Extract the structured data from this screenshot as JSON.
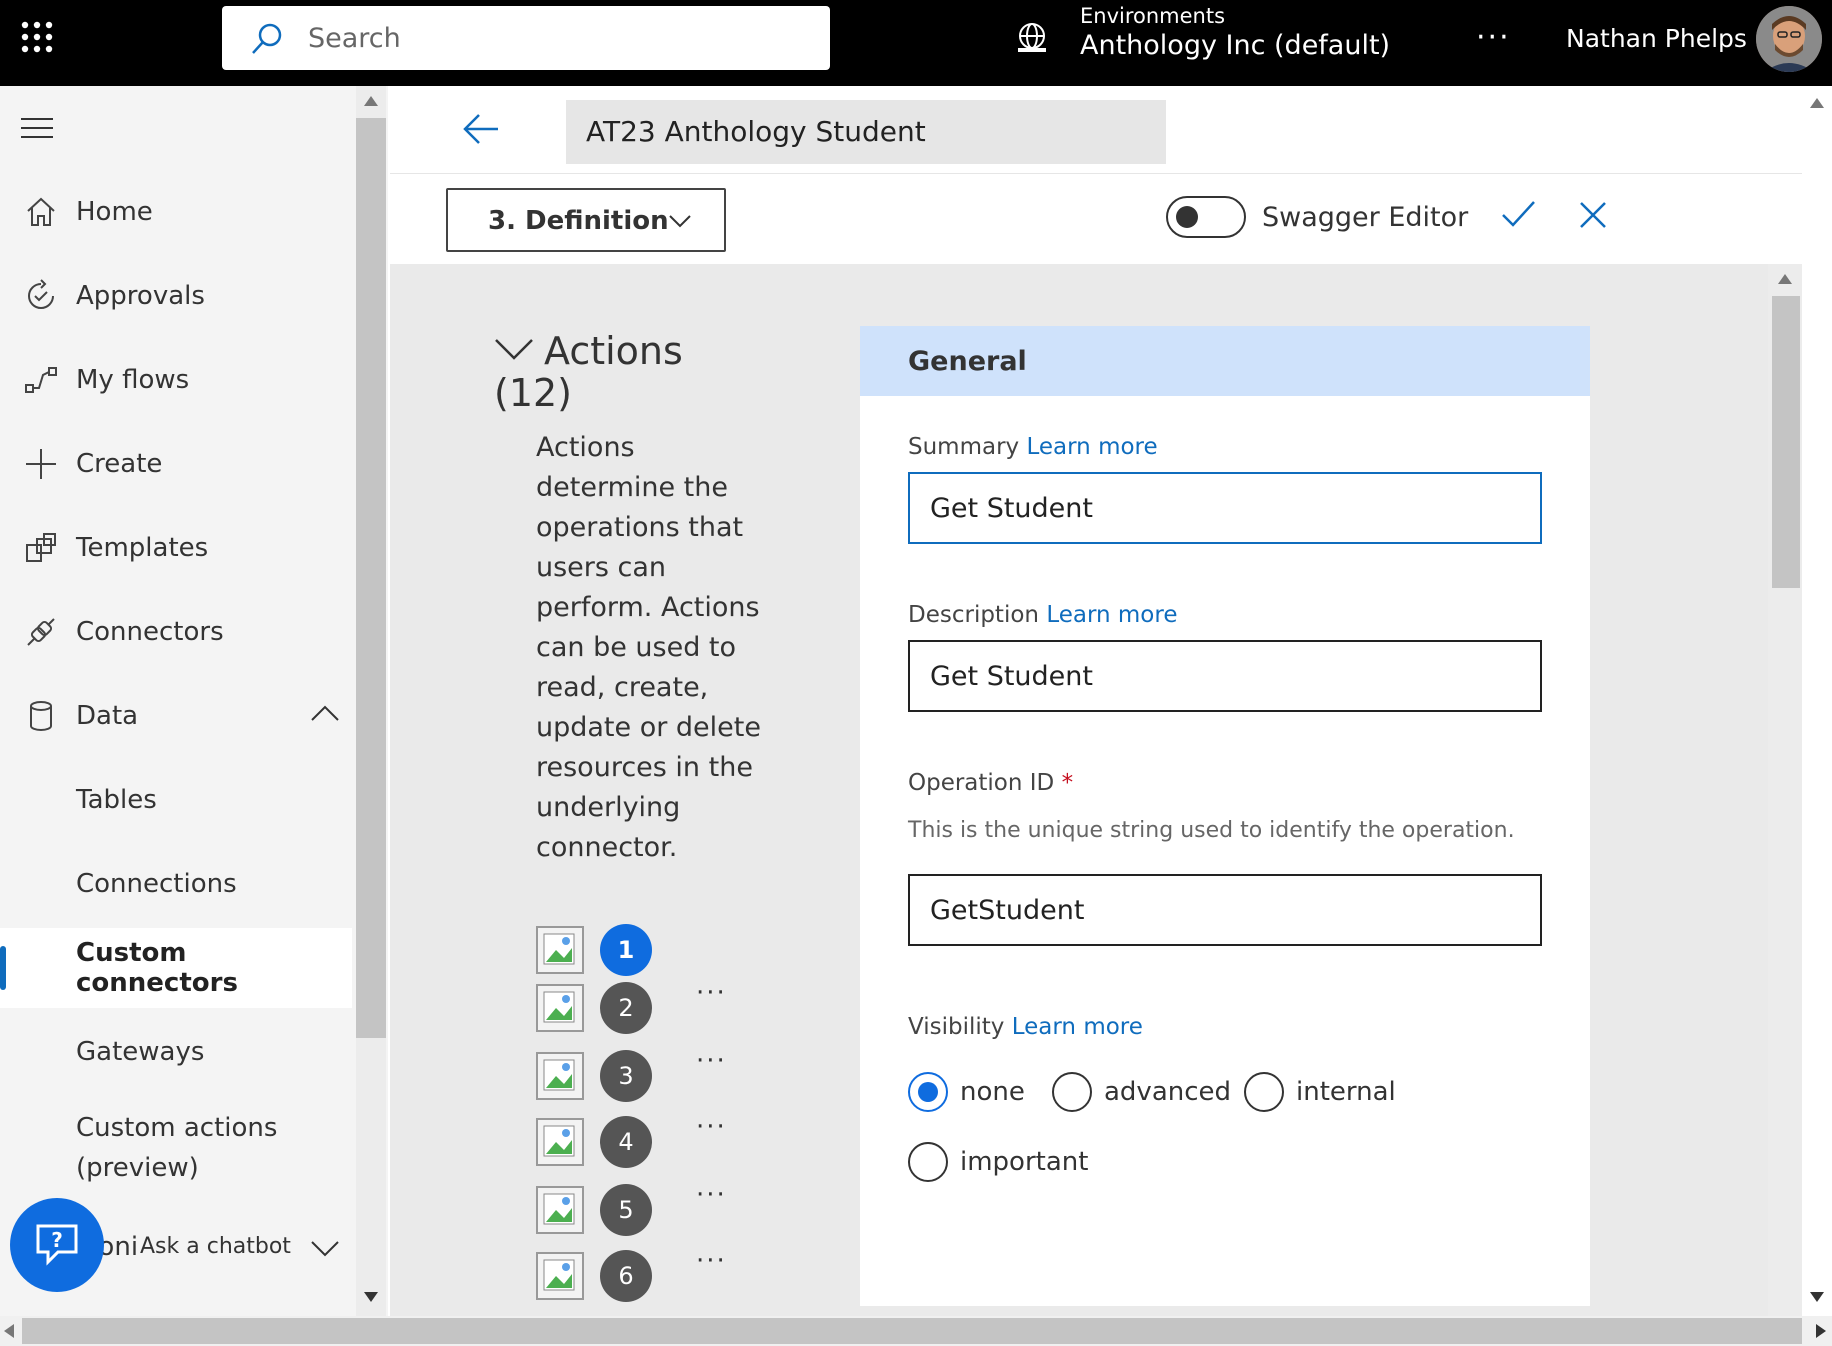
{
  "topbar": {
    "search_placeholder": "Search",
    "environments_label": "Environments",
    "environment_name": "Anthology Inc (default)",
    "more": "···",
    "user_name": "Nathan Phelps"
  },
  "nav": {
    "items": [
      {
        "label": "Home",
        "icon": "home-icon"
      },
      {
        "label": "Approvals",
        "icon": "approvals-icon"
      },
      {
        "label": "My flows",
        "icon": "flows-icon"
      },
      {
        "label": "Create",
        "icon": "plus-icon"
      },
      {
        "label": "Templates",
        "icon": "templates-icon"
      },
      {
        "label": "Connectors",
        "icon": "connector-icon"
      },
      {
        "label": "Data",
        "icon": "database-icon"
      },
      {
        "label": "Tables"
      },
      {
        "label": "Connections"
      },
      {
        "label": "Custom connectors"
      },
      {
        "label": "Gateways"
      },
      {
        "label": "Custom actions (preview)"
      },
      {
        "label": "Moni"
      }
    ],
    "active_item": "Custom connectors"
  },
  "chatbot": {
    "label": "Ask a chatbot"
  },
  "header": {
    "title": "AT23 Anthology Student"
  },
  "toolbar": {
    "step": "3. Definition",
    "swagger_label": "Swagger Editor",
    "swagger_on": false
  },
  "actions": {
    "title": "Actions (12)",
    "description": "Actions determine the operations that users can perform. Actions can be used to read, create, update or delete resources in the underlying connector.",
    "items": [
      "1",
      "2",
      "3",
      "4",
      "5",
      "6"
    ],
    "selected": "1",
    "more": "···"
  },
  "general": {
    "heading": "General",
    "summary_label": "Summary",
    "summary_value": "Get Student",
    "description_label": "Description",
    "description_value": "Get Student",
    "learn_more": "Learn more",
    "operation_id_label": "Operation ID",
    "required_mark": "*",
    "operation_id_help": "This is the unique string used to identify the operation.",
    "operation_id_value": "GetStudent",
    "visibility_label": "Visibility",
    "visibility_options": [
      "none",
      "advanced",
      "internal",
      "important"
    ],
    "visibility_selected": "none"
  },
  "colors": {
    "accent": "#0f6cdf",
    "topbar_bg": "#000000",
    "panel_header": "#cfe2fb"
  }
}
